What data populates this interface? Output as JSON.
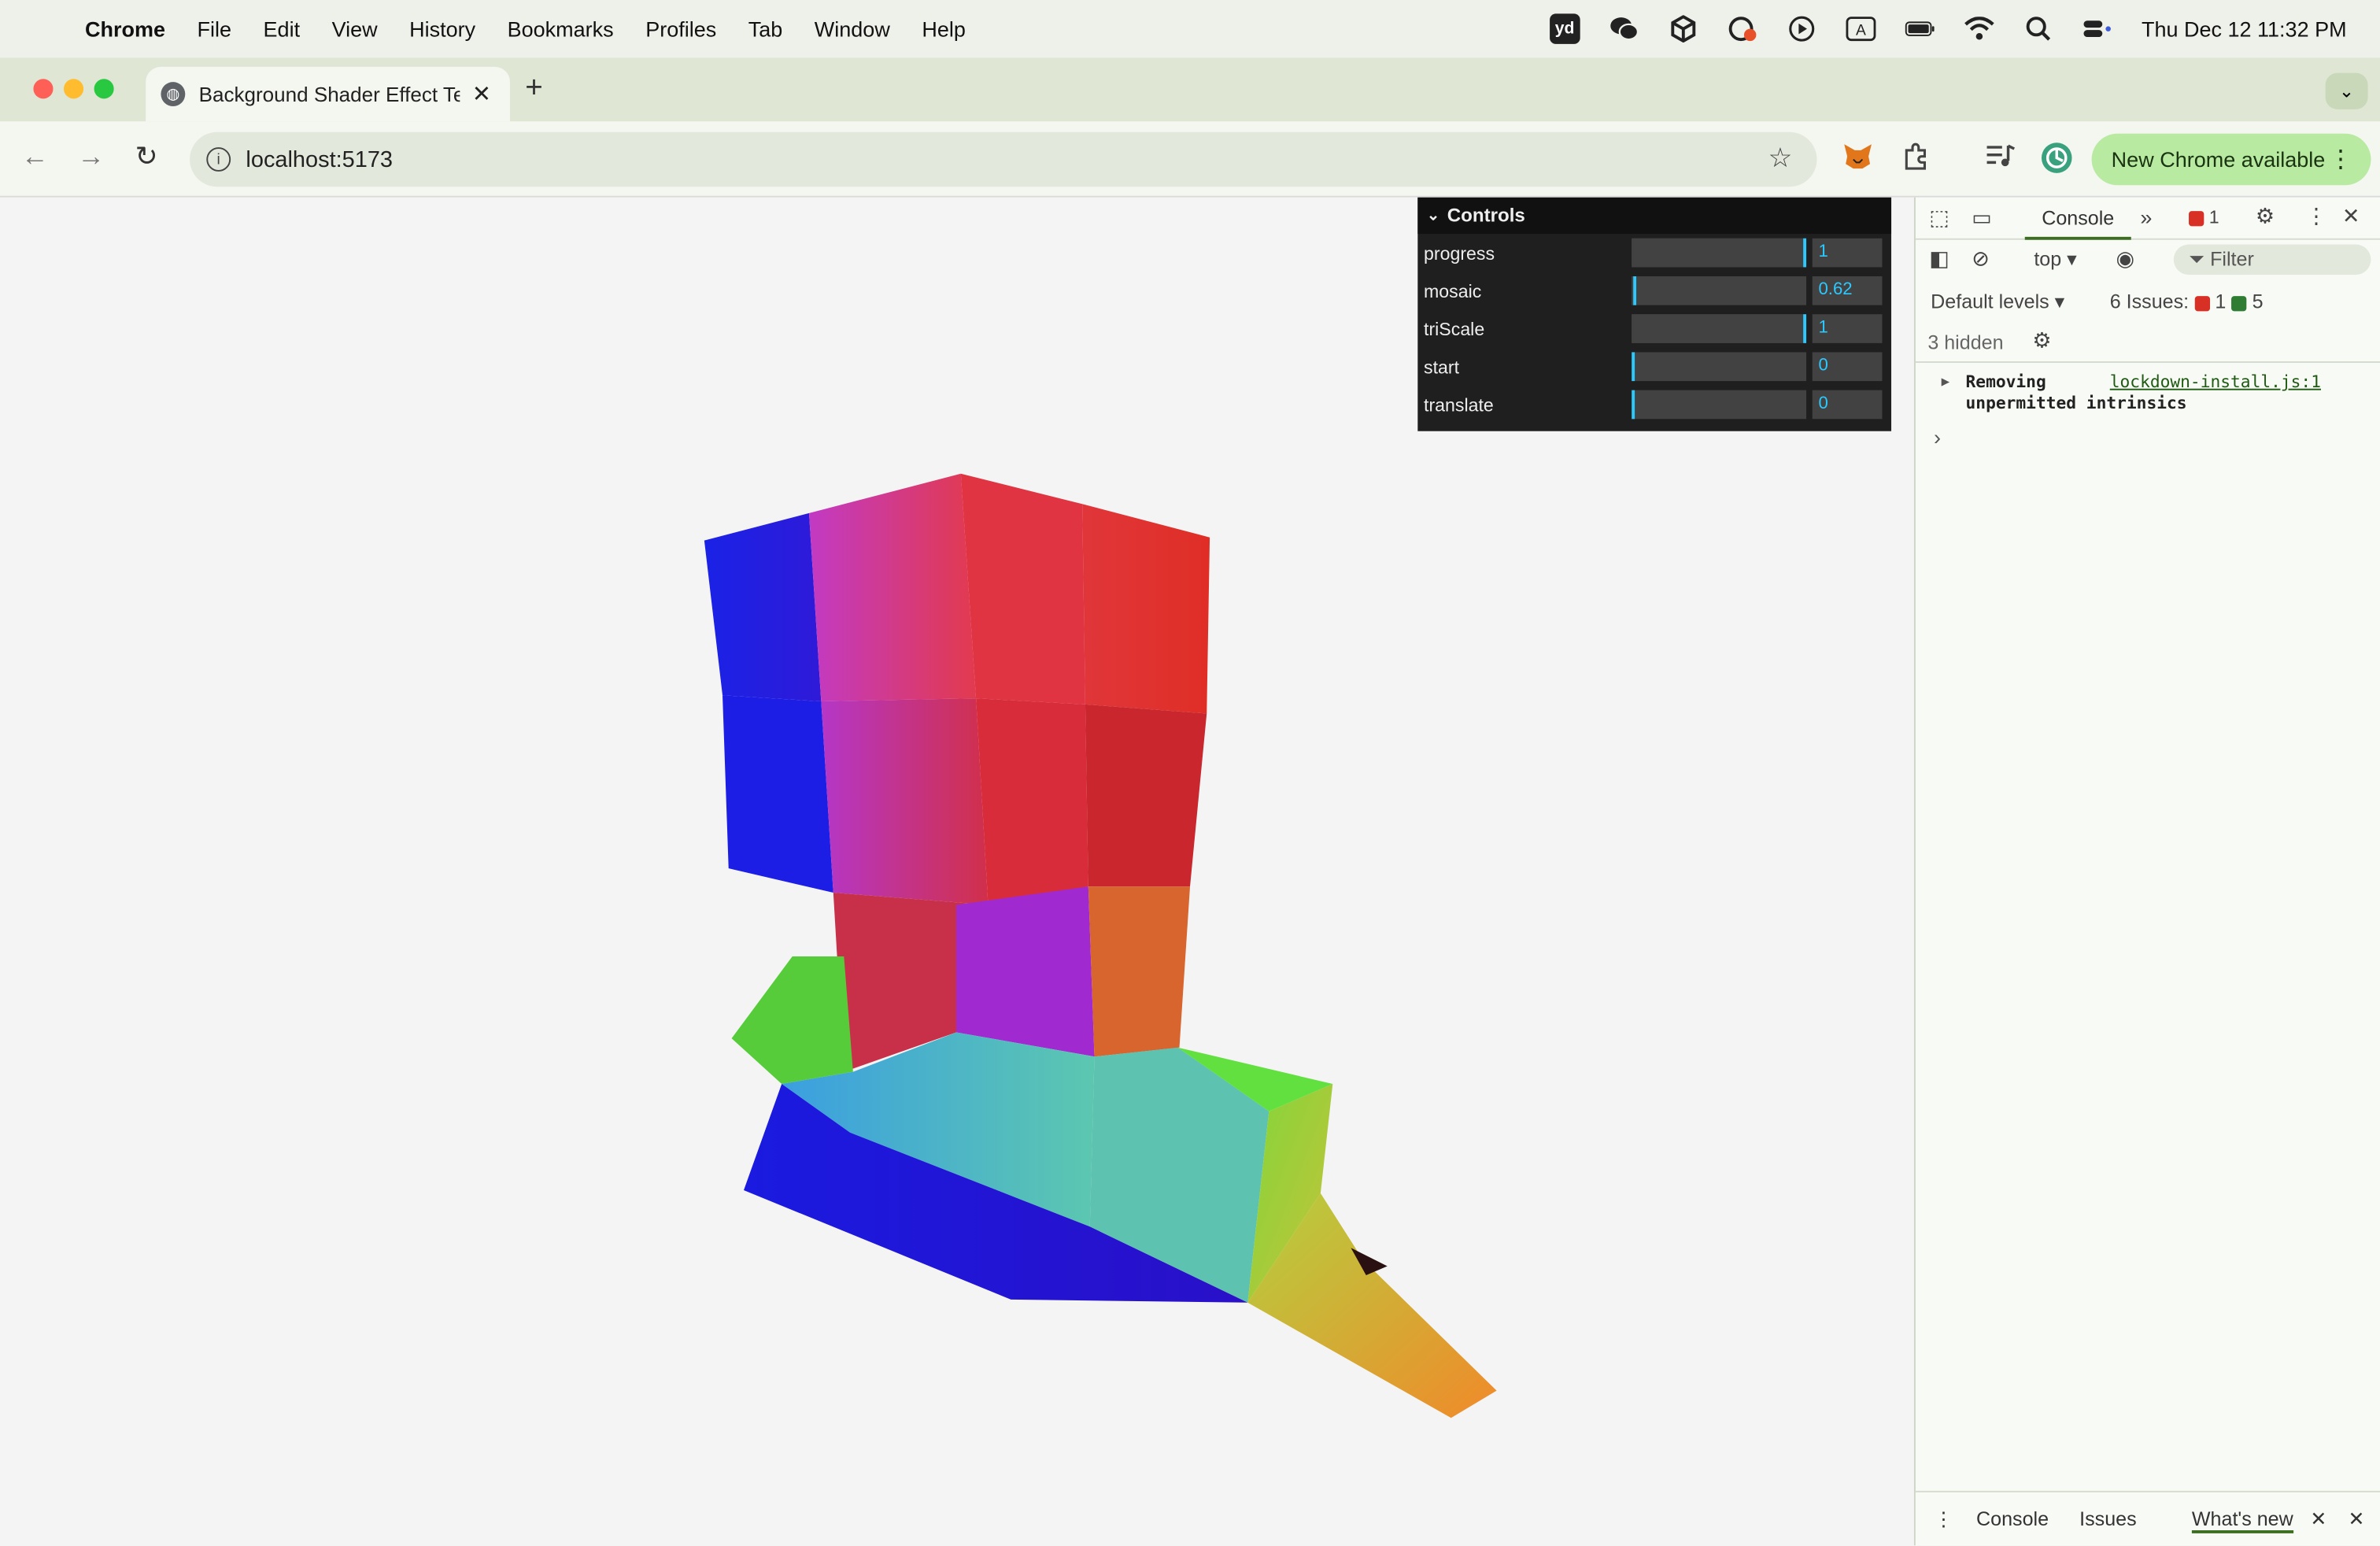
{
  "menubar": {
    "app": "Chrome",
    "items": [
      "File",
      "Edit",
      "View",
      "History",
      "Bookmarks",
      "Profiles",
      "Tab",
      "Window",
      "Help"
    ],
    "clock": "Thu Dec 12  11:32 PM",
    "status_icons": [
      "youdao-icon",
      "wechat-icon",
      "box-icon",
      "cast-icon",
      "play-icon",
      "input-source-icon",
      "battery-icon",
      "wifi-icon",
      "spotlight-icon",
      "control-center-icon"
    ]
  },
  "tab": {
    "title": "Background Shader Effect Test",
    "close": "✕"
  },
  "toolbar": {
    "url": "localhost:5173",
    "new_chrome": "New Chrome available"
  },
  "controls": {
    "title": "Controls",
    "rows": [
      {
        "label": "progress",
        "value": "1",
        "fraction": 1.0
      },
      {
        "label": "mosaic",
        "value": "0.62",
        "fraction": 0.03
      },
      {
        "label": "triScale",
        "value": "1",
        "fraction": 1.0
      },
      {
        "label": "start",
        "value": "0",
        "fraction": 0.0
      },
      {
        "label": "translate",
        "value": "0",
        "fraction": 0.0
      }
    ]
  },
  "devtools": {
    "tab_console": "Console",
    "error_count": "1",
    "context": "top",
    "filter_placeholder": "Filter",
    "levels": "Default levels",
    "issues_label": "6 Issues:",
    "issues_errors": "1",
    "issues_messages": "5",
    "hidden": "3 hidden",
    "log_message_line1": "Removing",
    "log_message_line2": "unpermitted intrinsics",
    "log_source": "lockdown-install.js:1",
    "drawer_tabs": [
      "Console",
      "Issues",
      "What's new"
    ]
  },
  "colors": {
    "accent_green": "#b8eaa2",
    "slider_blue": "#2cc9ff",
    "tabstrip": "#dfe7d4"
  }
}
